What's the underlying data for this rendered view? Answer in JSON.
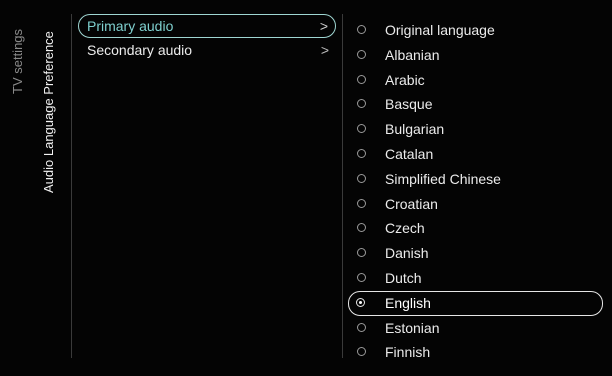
{
  "breadcrumb": {
    "root": "TV settings",
    "page": "Audio Language Preference"
  },
  "menu": {
    "items": [
      {
        "label": "Primary audio",
        "chevron": ">",
        "selected": true
      },
      {
        "label": "Secondary audio",
        "chevron": ">",
        "selected": false
      }
    ]
  },
  "options": {
    "selected": "English",
    "items": [
      "Original language",
      "Albanian",
      "Arabic",
      "Basque",
      "Bulgarian",
      "Catalan",
      "Simplified Chinese",
      "Croatian",
      "Czech",
      "Danish",
      "Dutch",
      "English",
      "Estonian",
      "Finnish"
    ]
  },
  "colors": {
    "background": "#040404",
    "accent": "#7fd0cf",
    "text": "#ececec"
  }
}
